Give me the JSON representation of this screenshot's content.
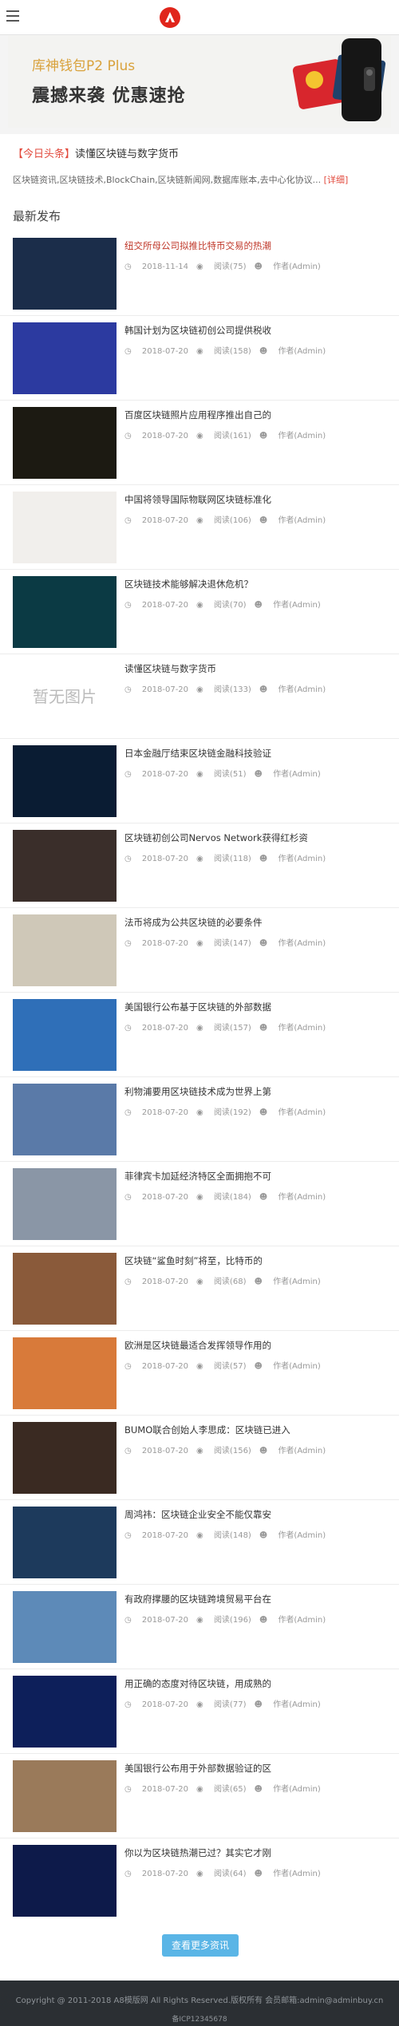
{
  "header": {
    "menu_icon": "hamburger-icon",
    "logo_icon": "brand-logo-icon"
  },
  "banner": {
    "title": "库神钱包P2 Plus",
    "subtitle": "震撼来袭 优惠速抢"
  },
  "headline": {
    "tag": "【今日头条】",
    "title": "读懂区块链与数字货币",
    "desc": "区块链资讯,区块链技术,BlockChain,区块链新闻网,数据库账本,去中心化协议...",
    "more": "[详细]"
  },
  "section_title": "最新发布",
  "articles": [
    {
      "title": "纽交所母公司拟推比特币交易的热潮",
      "date": "2018-11-14",
      "views": "阅读(75)",
      "author": "作者(Admin)",
      "hot": true,
      "thumb": "#1b2d4a"
    },
    {
      "title": "韩国计划为区块链初创公司提供税收",
      "date": "2018-07-20",
      "views": "阅读(158)",
      "author": "作者(Admin)",
      "thumb": "#2c3aa0"
    },
    {
      "title": "百度区块链照片应用程序推出自己的",
      "date": "2018-07-20",
      "views": "阅读(161)",
      "author": "作者(Admin)",
      "thumb": "#1c1a12"
    },
    {
      "title": "中国将领导国际物联网区块链标准化",
      "date": "2018-07-20",
      "views": "阅读(106)",
      "author": "作者(Admin)",
      "thumb": "#f1efec"
    },
    {
      "title": "区块链技术能够解决退休危机？",
      "date": "2018-07-20",
      "views": "阅读(70)",
      "author": "作者(Admin)",
      "thumb": "#0b3a44"
    },
    {
      "title": "读懂区块链与数字货币",
      "date": "2018-07-20",
      "views": "阅读(133)",
      "author": "作者(Admin)",
      "thumb": "#ffffff",
      "placeholder": "暂无图片"
    },
    {
      "title": "日本金融厅结束区块链金融科技验证",
      "date": "2018-07-20",
      "views": "阅读(51)",
      "author": "作者(Admin)",
      "thumb": "#0a1c33"
    },
    {
      "title": "区块链初创公司Nervos Network获得红杉资",
      "date": "2018-07-20",
      "views": "阅读(118)",
      "author": "作者(Admin)",
      "thumb": "#3a2e2a"
    },
    {
      "title": "法币将成为公共区块链的必要条件",
      "date": "2018-07-20",
      "views": "阅读(147)",
      "author": "作者(Admin)",
      "thumb": "#cfc8b8"
    },
    {
      "title": "美国银行公布基于区块链的外部数据",
      "date": "2018-07-20",
      "views": "阅读(157)",
      "author": "作者(Admin)",
      "thumb": "#2f6fb8"
    },
    {
      "title": "利物浦要用区块链技术成为世界上第",
      "date": "2018-07-20",
      "views": "阅读(192)",
      "author": "作者(Admin)",
      "thumb": "#5a7aa8"
    },
    {
      "title": "菲律宾卡加延经济特区全面拥抱不可",
      "date": "2018-07-20",
      "views": "阅读(184)",
      "author": "作者(Admin)",
      "thumb": "#8a96a6"
    },
    {
      "title": "区块链“鲨鱼时刻”将至，比特币的",
      "date": "2018-07-20",
      "views": "阅读(68)",
      "author": "作者(Admin)",
      "thumb": "#8a5a3a"
    },
    {
      "title": "欧洲是区块链最适合发挥领导作用的",
      "date": "2018-07-20",
      "views": "阅读(57)",
      "author": "作者(Admin)",
      "thumb": "#d87a3a"
    },
    {
      "title": "BUMO联合创始人李思成：区块链已进入",
      "date": "2018-07-20",
      "views": "阅读(156)",
      "author": "作者(Admin)",
      "thumb": "#3a2a22"
    },
    {
      "title": "周鸿祎：区块链企业安全不能仅靠安",
      "date": "2018-07-20",
      "views": "阅读(148)",
      "author": "作者(Admin)",
      "thumb": "#1d3a5c"
    },
    {
      "title": "有政府撑腰的区块链跨境贸易平台在",
      "date": "2018-07-20",
      "views": "阅读(196)",
      "author": "作者(Admin)",
      "thumb": "#5d8ab8"
    },
    {
      "title": "用正确的态度对待区块链，用成熟的",
      "date": "2018-07-20",
      "views": "阅读(77)",
      "author": "作者(Admin)",
      "thumb": "#0d1f5a"
    },
    {
      "title": "美国银行公布用于外部数据验证的区",
      "date": "2018-07-20",
      "views": "阅读(65)",
      "author": "作者(Admin)",
      "thumb": "#9a7a5a"
    },
    {
      "title": "你以为区块链热潮已过？其实它才刚",
      "date": "2018-07-20",
      "views": "阅读(64)",
      "author": "作者(Admin)",
      "thumb": "#0d1a4a"
    }
  ],
  "more_button": "查看更多资讯",
  "footer": {
    "copyright": "Copyright @ 2011-2018 A8模版网 All Rights Reserved.版权所有 会员邮箱:admin@adminbuy.cn",
    "icp": "备ICP12345678"
  }
}
